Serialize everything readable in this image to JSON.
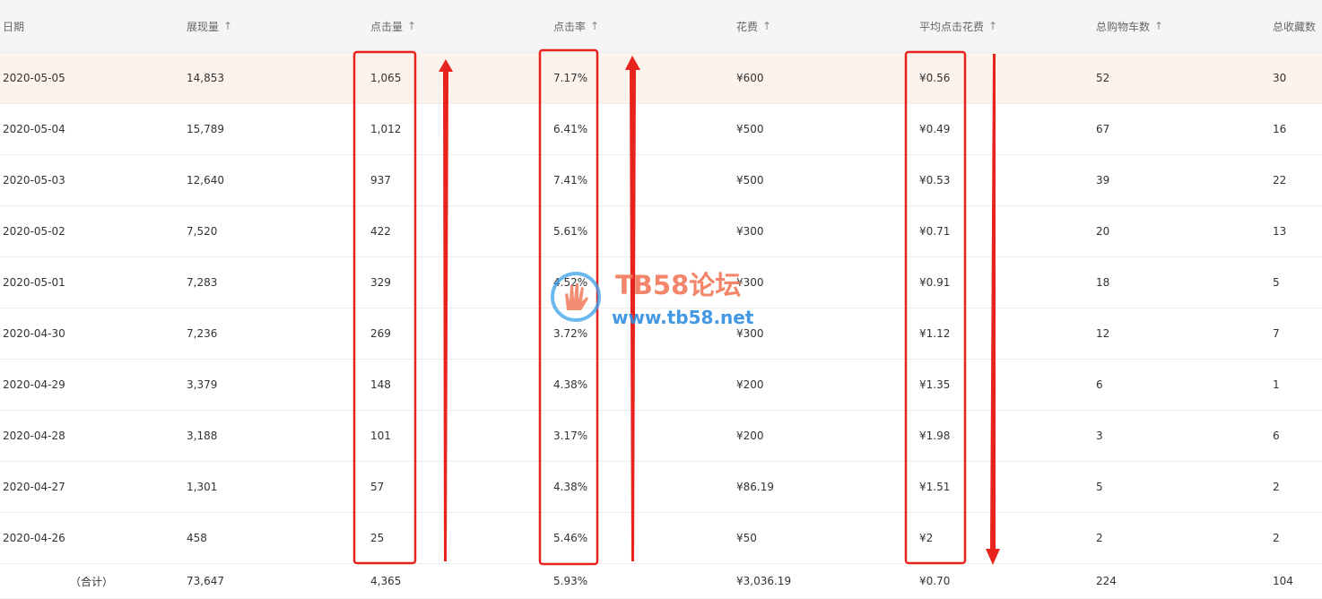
{
  "table": {
    "headers": [
      {
        "label": "日期",
        "sortable": false
      },
      {
        "label": "展现量",
        "sortable": true
      },
      {
        "label": "点击量",
        "sortable": true
      },
      {
        "label": "点击率",
        "sortable": true
      },
      {
        "label": "花费",
        "sortable": true
      },
      {
        "label": "平均点击花费",
        "sortable": true
      },
      {
        "label": "总购物车数",
        "sortable": true
      },
      {
        "label": "总收藏数",
        "sortable": false
      }
    ],
    "sort_arrow": "↑",
    "rows": [
      [
        "2020-05-05",
        "14,853",
        "1,065",
        "7.17%",
        "¥600",
        "¥0.56",
        "52",
        "30"
      ],
      [
        "2020-05-04",
        "15,789",
        "1,012",
        "6.41%",
        "¥500",
        "¥0.49",
        "67",
        "16"
      ],
      [
        "2020-05-03",
        "12,640",
        "937",
        "7.41%",
        "¥500",
        "¥0.53",
        "39",
        "22"
      ],
      [
        "2020-05-02",
        "7,520",
        "422",
        "5.61%",
        "¥300",
        "¥0.71",
        "20",
        "13"
      ],
      [
        "2020-05-01",
        "7,283",
        "329",
        "4.52%",
        "¥300",
        "¥0.91",
        "18",
        "5"
      ],
      [
        "2020-04-30",
        "7,236",
        "269",
        "3.72%",
        "¥300",
        "¥1.12",
        "12",
        "7"
      ],
      [
        "2020-04-29",
        "3,379",
        "148",
        "4.38%",
        "¥200",
        "¥1.35",
        "6",
        "1"
      ],
      [
        "2020-04-28",
        "3,188",
        "101",
        "3.17%",
        "¥200",
        "¥1.98",
        "3",
        "6"
      ],
      [
        "2020-04-27",
        "1,301",
        "57",
        "4.38%",
        "¥86.19",
        "¥1.51",
        "5",
        "2"
      ],
      [
        "2020-04-26",
        "458",
        "25",
        "5.46%",
        "¥50",
        "¥2",
        "2",
        "2"
      ]
    ],
    "total": [
      "（合计）",
      "73,647",
      "4,365",
      "5.93%",
      "¥3,036.19",
      "¥0.70",
      "224",
      "104"
    ]
  },
  "watermark": {
    "title": "TB58论坛",
    "url": "www.tb58.net"
  },
  "colors": {
    "annotation_red": "#e8231d",
    "watermark_title": "#f27a5a",
    "watermark_url": "#2f8de0",
    "highlight_row": "#fcf3ec",
    "header_bg": "#f5f5f5"
  }
}
